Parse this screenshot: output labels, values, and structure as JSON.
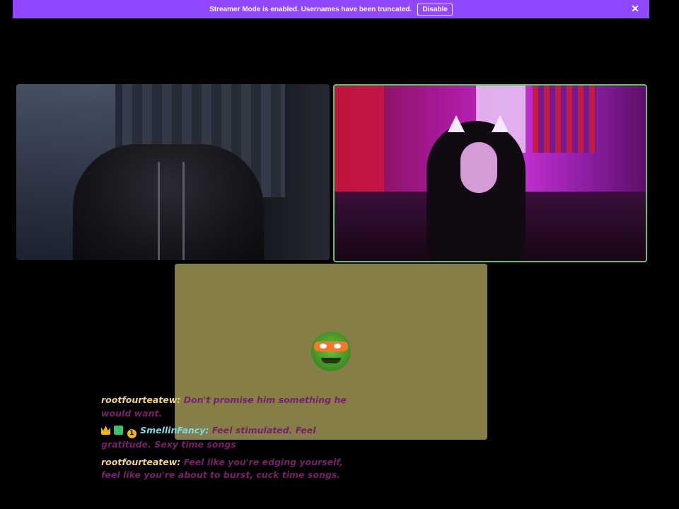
{
  "banner": {
    "message": "Streamer Mode is enabled. Usernames have been truncated.",
    "disable_label": "Disable",
    "close_icon": "close-icon",
    "color": "#9147ff"
  },
  "tiles": {
    "active_border_color": "#5fc45a",
    "avatar_tile_color": "#857f47"
  },
  "chat": {
    "messages": [
      {
        "user": "rootfourteatew:",
        "text": "Don't promise him something he would want."
      },
      {
        "user": "SmellinFancy:",
        "badge_number": "1",
        "text": "Feel stimulated. Feel gratitude. Sexy time songs"
      },
      {
        "user": "rootfourteatew:",
        "text": "Feel like you're edging yourself, feel like you're about to burst, cuck time songs."
      }
    ]
  }
}
